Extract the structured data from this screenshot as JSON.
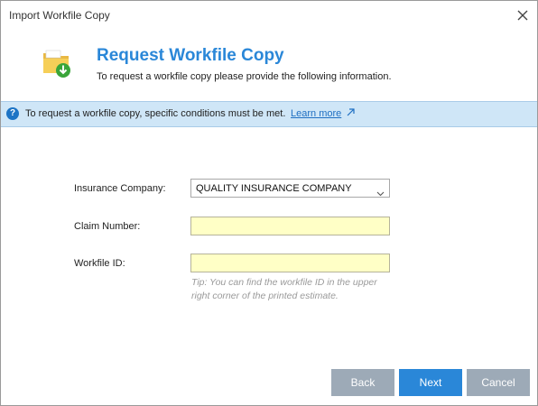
{
  "window": {
    "title": "Import Workfile Copy"
  },
  "header": {
    "title": "Request Workfile Copy",
    "subtitle": "To request a workfile copy please provide the following information."
  },
  "infobar": {
    "text": "To request a workfile copy, specific conditions must be met.",
    "link_label": "Learn more"
  },
  "form": {
    "insurance_label": "Insurance Company:",
    "insurance_value": "QUALITY INSURANCE COMPANY",
    "claim_label": "Claim Number:",
    "claim_value": "",
    "workfile_label": "Workfile ID:",
    "workfile_value": "",
    "tip_line1": "Tip: You can find the workfile ID in the upper",
    "tip_line2": "right corner of the printed estimate."
  },
  "buttons": {
    "back": "Back",
    "next": "Next",
    "cancel": "Cancel"
  },
  "colors": {
    "accent": "#2a87d8",
    "infobar_bg": "#cfe6f7",
    "field_bg": "#ffffc6",
    "secondary_button": "#9daab7"
  },
  "icons": {
    "header": "folder-download-icon",
    "info": "question-icon",
    "external": "external-link-icon",
    "close": "close-icon",
    "dropdown": "chevron-down-icon"
  }
}
